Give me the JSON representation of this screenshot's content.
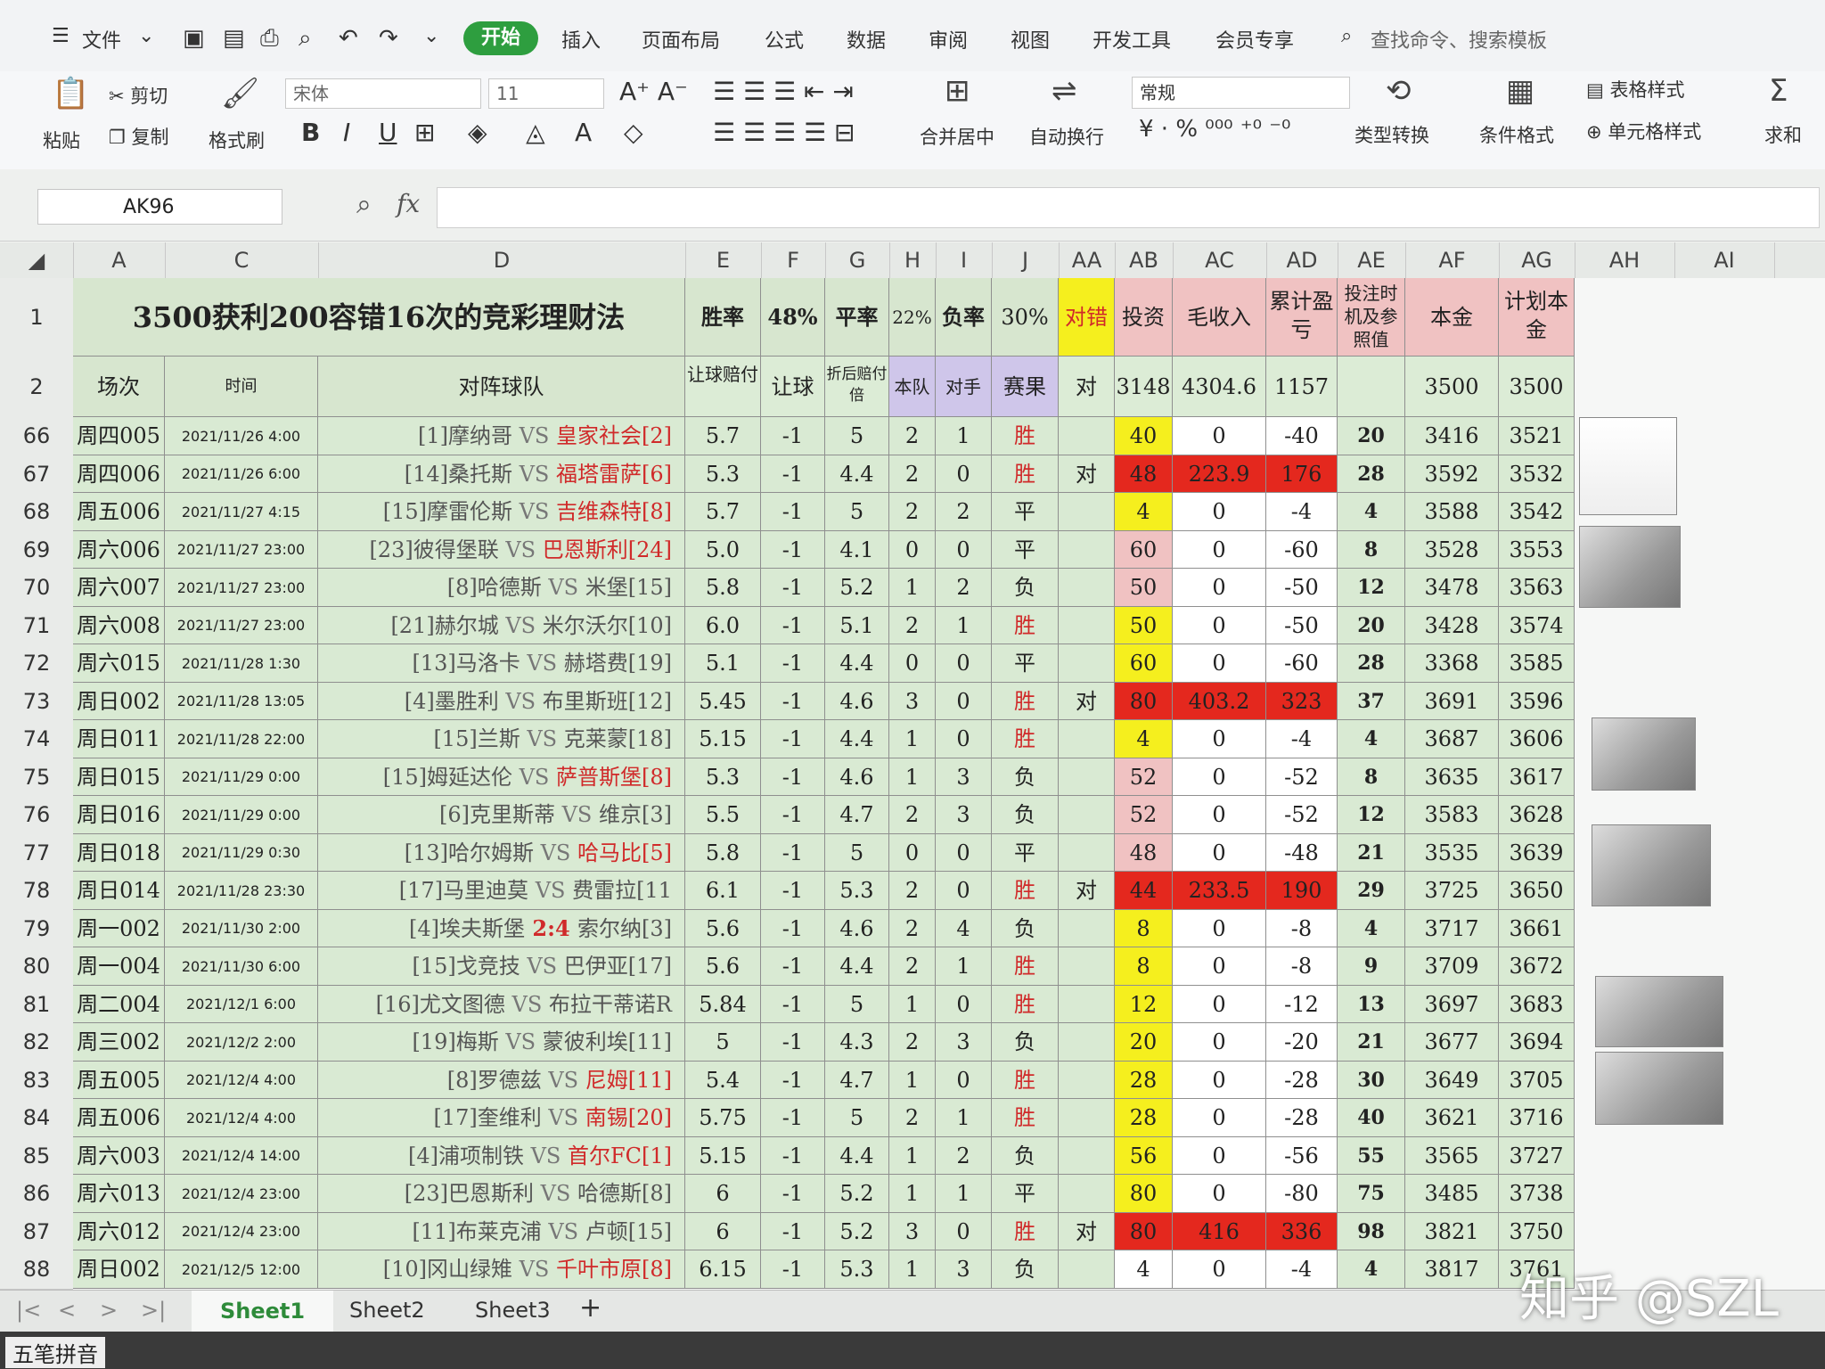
{
  "menubar": {
    "file": "文件",
    "tabs": [
      "开始",
      "插入",
      "页面布局",
      "公式",
      "数据",
      "审阅",
      "视图",
      "开发工具",
      "会员专享"
    ],
    "search": "查找命令、搜索模板"
  },
  "ribbon": {
    "paste": "粘贴",
    "cut": "剪切",
    "copy": "复制",
    "format_painter": "格式刷",
    "font": "宋体",
    "size": "11",
    "merge": "合并居中",
    "wrap": "自动换行",
    "number_format": "常规",
    "type_convert": "类型转换",
    "cond_format": "条件格式",
    "table_style": "表格样式",
    "cell_style": "单元格样式",
    "sum": "求和"
  },
  "formula_bar": {
    "name_box": "AK96",
    "fx": "fx",
    "content": ""
  },
  "columns": [
    "A",
    "C",
    "D",
    "E",
    "F",
    "G",
    "H",
    "I",
    "J",
    "AA",
    "AB",
    "AC",
    "AD",
    "AE",
    "AF",
    "AG",
    "AH",
    "AI"
  ],
  "header_row1": {
    "title": "3500获利200容错16次的竞彩理财法",
    "win_rate_label": "胜率",
    "win_rate": "48%",
    "draw_rate_label": "平率",
    "draw_rate": "22%",
    "loss_rate_label": "负率",
    "loss_rate": "30%",
    "right_wrong": "对错",
    "invest": "投资",
    "gross": "毛收入",
    "cumulative": "累计盈亏",
    "bet_timing": "投注时机及参照值",
    "principal": "本金",
    "plan_principal": "计划本金"
  },
  "header_row2": {
    "match_no": "场次",
    "time": "时间",
    "teams": "对阵球队",
    "handicap_odds": "让球赔付",
    "handicap": "让球",
    "discounted_odds": "折后赔付倍",
    "home": "本队",
    "away": "对手",
    "result": "赛果",
    "aa": "对",
    "ab": "3148",
    "ac": "4304.6",
    "ad": "1157",
    "af": "3500",
    "ag": "3500"
  },
  "rows": [
    {
      "r": "66",
      "a": "周四005",
      "c": "2021/11/26 4:00",
      "tl": "[1]摩纳哥",
      "vs": " VS ",
      "tr": "皇家社会[2]",
      "rc": "r",
      "e": "5.7",
      "f": "-1",
      "g": "5",
      "h": "2",
      "i": "1",
      "j": "胜",
      "aa": "",
      "ab": "40",
      "abc": "yellow",
      "ac": "0",
      "acc": "",
      "ad": "-40",
      "adc": "",
      "ae": "20",
      "af": "3416",
      "ag": "3521"
    },
    {
      "r": "67",
      "a": "周四006",
      "c": "2021/11/26 6:00",
      "tl": "[14]桑托斯",
      "vs": " VS ",
      "tr": "福塔雷萨[6]",
      "rc": "r",
      "e": "5.3",
      "f": "-1",
      "g": "4.4",
      "h": "2",
      "i": "0",
      "j": "胜",
      "aa": "对",
      "ab": "48",
      "abc": "red",
      "ac": "223.9",
      "acc": "red",
      "ad": "176",
      "adc": "red",
      "ae": "28",
      "af": "3592",
      "ag": "3532"
    },
    {
      "r": "68",
      "a": "周五006",
      "c": "2021/11/27 4:15",
      "tl": "[15]摩雷伦斯",
      "vs": " VS ",
      "tr": "吉维森特[8]",
      "rc": "r",
      "e": "5.7",
      "f": "-1",
      "g": "5",
      "h": "2",
      "i": "2",
      "j": "平",
      "aa": "",
      "ab": "4",
      "abc": "yellow",
      "ac": "0",
      "acc": "",
      "ad": "-4",
      "adc": "",
      "ae": "4",
      "af": "3588",
      "ag": "3542"
    },
    {
      "r": "69",
      "a": "周六006",
      "c": "2021/11/27 23:00",
      "tl": "[23]彼得堡联",
      "vs": " VS ",
      "tr": "巴恩斯利[24]",
      "rc": "r",
      "e": "5.0",
      "f": "-1",
      "g": "4.1",
      "h": "0",
      "i": "0",
      "j": "平",
      "aa": "",
      "ab": "60",
      "abc": "pink",
      "ac": "0",
      "acc": "",
      "ad": "-60",
      "adc": "",
      "ae": "8",
      "af": "3528",
      "ag": "3553"
    },
    {
      "r": "70",
      "a": "周六007",
      "c": "2021/11/27 23:00",
      "tl": "[8]哈德斯",
      "vs": " VS ",
      "tr": "米堡[15]",
      "rc": "g",
      "e": "5.8",
      "f": "-1",
      "g": "5.2",
      "h": "1",
      "i": "2",
      "j": "负",
      "aa": "",
      "ab": "50",
      "abc": "pink",
      "ac": "0",
      "acc": "",
      "ad": "-50",
      "adc": "",
      "ae": "12",
      "af": "3478",
      "ag": "3563"
    },
    {
      "r": "71",
      "a": "周六008",
      "c": "2021/11/27 23:00",
      "tl": "[21]赫尔城",
      "vs": " VS ",
      "tr": "米尔沃尔[10]",
      "rc": "g",
      "e": "6.0",
      "f": "-1",
      "g": "5.1",
      "h": "2",
      "i": "1",
      "j": "胜",
      "aa": "",
      "ab": "50",
      "abc": "yellow",
      "ac": "0",
      "acc": "",
      "ad": "-50",
      "adc": "",
      "ae": "20",
      "af": "3428",
      "ag": "3574"
    },
    {
      "r": "72",
      "a": "周六015",
      "c": "2021/11/28 1:30",
      "tl": "[13]马洛卡",
      "vs": " VS ",
      "tr": "赫塔费[19]",
      "rc": "g",
      "e": "5.1",
      "f": "-1",
      "g": "4.4",
      "h": "0",
      "i": "0",
      "j": "平",
      "aa": "",
      "ab": "60",
      "abc": "yellow",
      "ac": "0",
      "acc": "",
      "ad": "-60",
      "adc": "",
      "ae": "28",
      "af": "3368",
      "ag": "3585"
    },
    {
      "r": "73",
      "a": "周日002",
      "c": "2021/11/28 13:05",
      "tl": "[4]墨胜利",
      "vs": " VS ",
      "tr": "布里斯班[12]",
      "rc": "g",
      "e": "5.45",
      "f": "-1",
      "g": "4.6",
      "h": "3",
      "i": "0",
      "j": "胜",
      "aa": "对",
      "ab": "80",
      "abc": "red",
      "ac": "403.2",
      "acc": "red",
      "ad": "323",
      "adc": "red",
      "ae": "37",
      "af": "3691",
      "ag": "3596"
    },
    {
      "r": "74",
      "a": "周日011",
      "c": "2021/11/28 22:00",
      "tl": "[15]兰斯",
      "vs": " VS ",
      "tr": "克莱蒙[18]",
      "rc": "g",
      "e": "5.15",
      "f": "-1",
      "g": "4.4",
      "h": "1",
      "i": "0",
      "j": "胜",
      "aa": "",
      "ab": "4",
      "abc": "yellow",
      "ac": "0",
      "acc": "",
      "ad": "-4",
      "adc": "",
      "ae": "4",
      "af": "3687",
      "ag": "3606"
    },
    {
      "r": "75",
      "a": "周日015",
      "c": "2021/11/29 0:00",
      "tl": "[15]姆延达伦",
      "vs": " VS ",
      "tr": "萨普斯堡[8]",
      "rc": "r",
      "e": "5.3",
      "f": "-1",
      "g": "4.6",
      "h": "1",
      "i": "3",
      "j": "负",
      "aa": "",
      "ab": "52",
      "abc": "pink",
      "ac": "0",
      "acc": "",
      "ad": "-52",
      "adc": "",
      "ae": "8",
      "af": "3635",
      "ag": "3617"
    },
    {
      "r": "76",
      "a": "周日016",
      "c": "2021/11/29 0:00",
      "tl": "[6]克里斯蒂",
      "vs": " VS ",
      "tr": "维京[3]",
      "rc": "g",
      "e": "5.5",
      "f": "-1",
      "g": "4.7",
      "h": "2",
      "i": "3",
      "j": "负",
      "aa": "",
      "ab": "52",
      "abc": "pink",
      "ac": "0",
      "acc": "",
      "ad": "-52",
      "adc": "",
      "ae": "12",
      "af": "3583",
      "ag": "3628"
    },
    {
      "r": "77",
      "a": "周日018",
      "c": "2021/11/29 0:30",
      "tl": "[13]哈尔姆斯",
      "vs": " VS ",
      "tr": "哈马比[5]",
      "rc": "r",
      "e": "5.8",
      "f": "-1",
      "g": "5",
      "h": "0",
      "i": "0",
      "j": "平",
      "aa": "",
      "ab": "48",
      "abc": "pink",
      "ac": "0",
      "acc": "",
      "ad": "-48",
      "adc": "",
      "ae": "21",
      "af": "3535",
      "ag": "3639"
    },
    {
      "r": "78",
      "a": "周日014",
      "c": "2021/11/28 23:30",
      "tl": "[17]马里迪莫",
      "vs": " VS ",
      "tr": "费雷拉[11",
      "rc": "g",
      "e": "6.1",
      "f": "-1",
      "g": "5.3",
      "h": "2",
      "i": "0",
      "j": "胜",
      "aa": "对",
      "ab": "44",
      "abc": "red",
      "ac": "233.5",
      "acc": "red",
      "ad": "190",
      "adc": "red",
      "ae": "29",
      "af": "3725",
      "ag": "3650"
    },
    {
      "r": "79",
      "a": "周一002",
      "c": "2021/11/30 2:00",
      "tl": "[4]埃夫斯堡",
      "vs": " 2:4 ",
      "tr": "索尔纳[3]",
      "rc": "g",
      "e": "5.6",
      "f": "-1",
      "g": "4.6",
      "h": "2",
      "i": "4",
      "j": "负",
      "aa": "",
      "ab": "8",
      "abc": "yellow",
      "ac": "0",
      "acc": "",
      "ad": "-8",
      "adc": "",
      "ae": "4",
      "af": "3717",
      "ag": "3661"
    },
    {
      "r": "80",
      "a": "周一004",
      "c": "2021/11/30 6:00",
      "tl": "[15]戈竞技",
      "vs": " VS ",
      "tr": "巴伊亚[17]",
      "rc": "g",
      "e": "5.6",
      "f": "-1",
      "g": "4.4",
      "h": "2",
      "i": "1",
      "j": "胜",
      "aa": "",
      "ab": "8",
      "abc": "yellow",
      "ac": "0",
      "acc": "",
      "ad": "-8",
      "adc": "",
      "ae": "9",
      "af": "3709",
      "ag": "3672"
    },
    {
      "r": "81",
      "a": "周二004",
      "c": "2021/12/1 6:00",
      "tl": "[16]尤文图德",
      "vs": " VS ",
      "tr": "布拉干蒂诺R",
      "rc": "g",
      "e": "5.84",
      "f": "-1",
      "g": "5",
      "h": "1",
      "i": "0",
      "j": "胜",
      "aa": "",
      "ab": "12",
      "abc": "yellow",
      "ac": "0",
      "acc": "",
      "ad": "-12",
      "adc": "",
      "ae": "13",
      "af": "3697",
      "ag": "3683"
    },
    {
      "r": "82",
      "a": "周三002",
      "c": "2021/12/2 2:00",
      "tl": "[19]梅斯",
      "vs": " VS ",
      "tr": "蒙彼利埃[11]",
      "rc": "g",
      "e": "5",
      "f": "-1",
      "g": "4.3",
      "h": "2",
      "i": "3",
      "j": "负",
      "aa": "",
      "ab": "20",
      "abc": "yellow",
      "ac": "0",
      "acc": "",
      "ad": "-20",
      "adc": "",
      "ae": "21",
      "af": "3677",
      "ag": "3694"
    },
    {
      "r": "83",
      "a": "周五005",
      "c": "2021/12/4 4:00",
      "tl": "[8]罗德兹",
      "vs": " VS ",
      "tr": "尼姆[11]",
      "rc": "r",
      "e": "5.4",
      "f": "-1",
      "g": "4.7",
      "h": "1",
      "i": "0",
      "j": "胜",
      "aa": "",
      "ab": "28",
      "abc": "yellow",
      "ac": "0",
      "acc": "",
      "ad": "-28",
      "adc": "",
      "ae": "30",
      "af": "3649",
      "ag": "3705"
    },
    {
      "r": "84",
      "a": "周五006",
      "c": "2021/12/4 4:00",
      "tl": "[17]奎维利",
      "vs": " VS ",
      "tr": "南锡[20]",
      "rc": "r",
      "e": "5.75",
      "f": "-1",
      "g": "5",
      "h": "2",
      "i": "1",
      "j": "胜",
      "aa": "",
      "ab": "28",
      "abc": "yellow",
      "ac": "0",
      "acc": "",
      "ad": "-28",
      "adc": "",
      "ae": "40",
      "af": "3621",
      "ag": "3716"
    },
    {
      "r": "85",
      "a": "周六003",
      "c": "2021/12/4 14:00",
      "tl": "[4]浦项制铁",
      "vs": " VS ",
      "tr": "首尔FC[1]",
      "rc": "r",
      "e": "5.15",
      "f": "-1",
      "g": "4.4",
      "h": "1",
      "i": "2",
      "j": "负",
      "aa": "",
      "ab": "56",
      "abc": "yellow",
      "ac": "0",
      "acc": "",
      "ad": "-56",
      "adc": "",
      "ae": "55",
      "af": "3565",
      "ag": "3727"
    },
    {
      "r": "86",
      "a": "周六013",
      "c": "2021/12/4 23:00",
      "tl": "[23]巴恩斯利",
      "vs": " VS ",
      "tr": "哈德斯[8]",
      "rc": "g",
      "e": "6",
      "f": "-1",
      "g": "5.2",
      "h": "1",
      "i": "1",
      "j": "平",
      "aa": "",
      "ab": "80",
      "abc": "yellow",
      "ac": "0",
      "acc": "",
      "ad": "-80",
      "adc": "",
      "ae": "75",
      "af": "3485",
      "ag": "3738"
    },
    {
      "r": "87",
      "a": "周六012",
      "c": "2021/12/4 23:00",
      "tl": "[11]布莱克浦",
      "vs": " VS ",
      "tr": "卢顿[15]",
      "rc": "g",
      "e": "6",
      "f": "-1",
      "g": "5.2",
      "h": "3",
      "i": "0",
      "j": "胜",
      "aa": "对",
      "ab": "80",
      "abc": "red",
      "ac": "416",
      "acc": "red",
      "ad": "336",
      "adc": "red",
      "ae": "98",
      "af": "3821",
      "ag": "3750"
    },
    {
      "r": "88",
      "a": "周日002",
      "c": "2021/12/5 12:00",
      "tl": "[10]冈山绿雉",
      "vs": " VS ",
      "tr": "千叶市原[8]",
      "rc": "r",
      "e": "6.15",
      "f": "-1",
      "g": "5.3",
      "h": "1",
      "i": "3",
      "j": "负",
      "aa": "",
      "ab": "4",
      "abc": "",
      "ac": "0",
      "acc": "",
      "ad": "-4",
      "adc": "",
      "ae": "4",
      "af": "3817",
      "ag": "3761"
    }
  ],
  "sheets": [
    "Sheet1",
    "Sheet2",
    "Sheet3"
  ],
  "ime": "五笔拼音",
  "watermark": "知乎 @SZL"
}
